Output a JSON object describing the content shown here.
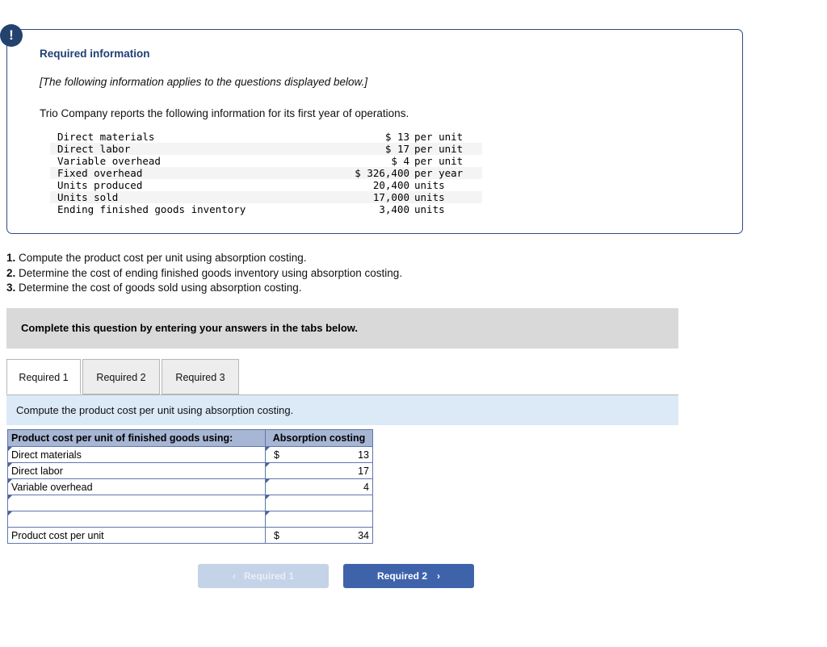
{
  "panel": {
    "alert_icon": "exclamation-icon",
    "title": "Required information",
    "subtitle": "[The following information applies to the questions displayed below.]",
    "lede": "Trio Company reports the following information for its first year of operations.",
    "facts": [
      {
        "label": "Direct materials",
        "amount": "$ 13",
        "suffix": "per unit"
      },
      {
        "label": "Direct labor",
        "amount": "$ 17",
        "suffix": "per unit"
      },
      {
        "label": "Variable overhead",
        "amount": "$ 4",
        "suffix": "per unit"
      },
      {
        "label": "Fixed overhead",
        "amount": "$ 326,400",
        "suffix": "per year"
      },
      {
        "label": "Units produced",
        "amount": "20,400",
        "suffix": "units"
      },
      {
        "label": "Units sold",
        "amount": "17,000",
        "suffix": "units"
      },
      {
        "label": "Ending finished goods inventory",
        "amount": "3,400",
        "suffix": "units"
      }
    ]
  },
  "requirements": [
    {
      "num": "1.",
      "text": "Compute the product cost per unit using absorption costing."
    },
    {
      "num": "2.",
      "text": "Determine the cost of ending finished goods inventory using absorption costing."
    },
    {
      "num": "3.",
      "text": "Determine the cost of goods sold using absorption costing."
    }
  ],
  "complete_bar": {
    "text": "Complete this question by entering your answers in the tabs below."
  },
  "tabs": [
    {
      "label": "Required 1",
      "active": true
    },
    {
      "label": "Required 2",
      "active": false
    },
    {
      "label": "Required 3",
      "active": false
    }
  ],
  "prompt": {
    "text": "Compute the product cost per unit using absorption costing."
  },
  "answer_grid": {
    "headers": {
      "label": "Product cost per unit of finished goods using:",
      "value": "Absorption costing"
    },
    "rows": [
      {
        "label": "Direct materials",
        "currency": "$",
        "value": "13",
        "editable": true,
        "total": false
      },
      {
        "label": "Direct labor",
        "currency": "",
        "value": "17",
        "editable": true,
        "total": false
      },
      {
        "label": "Variable overhead",
        "currency": "",
        "value": "4",
        "editable": true,
        "total": false
      },
      {
        "label": "",
        "currency": "",
        "value": "",
        "editable": true,
        "total": false
      },
      {
        "label": "",
        "currency": "",
        "value": "",
        "editable": true,
        "total": false
      },
      {
        "label": "Product cost per unit",
        "currency": "$",
        "value": "34",
        "editable": false,
        "total": true
      }
    ]
  },
  "nav": {
    "prev_label": "Required 1",
    "prev_chevron": "‹",
    "next_label": "Required 2",
    "next_chevron": "›"
  },
  "colors": {
    "panel_border": "#2e4b7c",
    "badge": "#23426e",
    "title_blue": "#1f3f73",
    "gray_bar": "#d9d9d9",
    "prompt_blue": "#dce9f7",
    "grid_header": "#a7b6d4",
    "grid_border": "#5f77ab",
    "total_yellow": "#fdfdb2",
    "next_button": "#3f63ab",
    "prev_button": "#c5d3e8"
  }
}
